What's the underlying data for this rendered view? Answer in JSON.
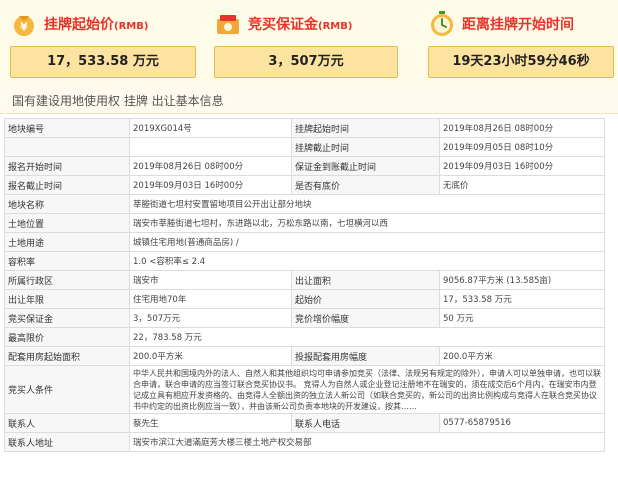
{
  "stats": [
    {
      "label": "挂牌起始价",
      "unit": "(RMB)",
      "value": "17，533.58 万元",
      "icon": "money-bag-icon"
    },
    {
      "label": "竞买保证金",
      "unit": "(RMB)",
      "value": "3，507万元",
      "icon": "deposit-icon"
    },
    {
      "label": "距离挂牌开始时间",
      "unit": "",
      "value": "19天23小时59分46秒",
      "icon": "countdown-icon"
    }
  ],
  "section": {
    "title": "国有建设用地使用权 挂牌 出让基本信息"
  },
  "rows": [
    {
      "type": "4",
      "l1": "地块编号",
      "v1": "2019XG014号",
      "l2": "挂牌起始时间",
      "v2": "2019年08月26日 08时00分"
    },
    {
      "type": "4",
      "l1": "",
      "v1": "",
      "l2": "挂牌截止时间",
      "v2": "2019年09月05日 08时10分"
    },
    {
      "type": "4",
      "l1": "报名开始时间",
      "v1": "2019年08月26日 08时00分",
      "l2": "保证金到账截止时间",
      "v2": "2019年09月03日 16时00分"
    },
    {
      "type": "4",
      "l1": "报名截止时间",
      "v1": "2019年09月03日 16时00分",
      "l2": "是否有底价",
      "v2": "无底价"
    },
    {
      "type": "2",
      "l1": "地块名称",
      "v1": "莘塍街道七坦村安置留地项目公开出让部分地块"
    },
    {
      "type": "2",
      "l1": "土地位置",
      "v1": "瑞安市莘塍街道七坦村，东进路以北，万松东路以南，七坦横河以西"
    },
    {
      "type": "2",
      "l1": "土地用途",
      "v1": "城镇住宅用地(普通商品房) /"
    },
    {
      "type": "2",
      "l1": "容积率",
      "v1": "1.0 <容积率≤ 2.4"
    },
    {
      "type": "4",
      "l1": "所属行政区",
      "v1": "瑞安市",
      "l2": "出让面积",
      "v2": "9056.87平方米 (13.585亩)"
    },
    {
      "type": "4",
      "l1": "出让年限",
      "v1": "住宅用地70年",
      "l2": "起始价",
      "v2": "17，533.58 万元"
    },
    {
      "type": "4",
      "l1": "竞买保证金",
      "v1": "3，507万元",
      "l2": "竞价增价幅度",
      "v2": "50 万元"
    },
    {
      "type": "2",
      "l1": "最高限价",
      "v1": "22，783.58 万元"
    },
    {
      "type": "4",
      "l1": "配套用房起始面积",
      "v1": "200.0平方米",
      "l2": "投报配套用房幅度",
      "v2": "200.0平方米"
    },
    {
      "type": "tall",
      "l1": "竞买人条件",
      "v1": "中华人民共和国境内外的法人、自然人和其他组织均可申请参加竞买（法律、法规另有规定的除外），申请人可以单独申请，也可以联合申请，联合申请的应当签订联合竞买协议书。 竞得人为自然人或企业登记注册地不在瑞安的，须在成交后6个月内，在瑞安市内登记成立具有相应开发资格的、由竞得人全额出资的独立法人新公司（如联合竞买的，新公司的出资比例构成与竞得人在联合竞买协议书中约定的出资比例应当一致），并由该新公司负责本地块的开发建设，按其……"
    },
    {
      "type": "4",
      "l1": "联系人",
      "v1": "蔡先生",
      "l2": "联系人电话",
      "v2": "0577-65879516"
    },
    {
      "type": "2",
      "l1": "联系人地址",
      "v1": "瑞安市滨江大道滿庭芳大楼三楼土地产权交易部"
    }
  ]
}
